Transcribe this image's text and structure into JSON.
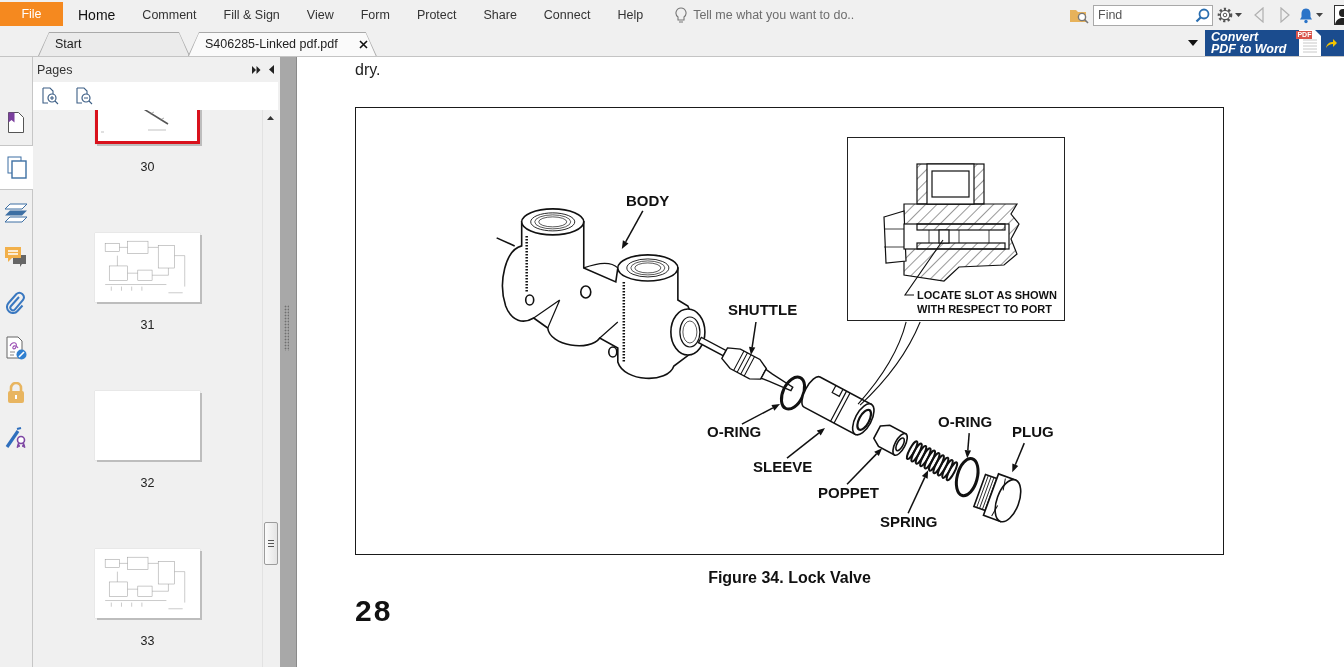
{
  "menu": {
    "file": "File",
    "tabs": [
      {
        "label": "Home",
        "selected": true
      },
      {
        "label": "Comment",
        "selected": false
      },
      {
        "label": "Fill & Sign",
        "selected": false
      },
      {
        "label": "View",
        "selected": false
      },
      {
        "label": "Form",
        "selected": false
      },
      {
        "label": "Protect",
        "selected": false
      },
      {
        "label": "Share",
        "selected": false
      },
      {
        "label": "Connect",
        "selected": false
      },
      {
        "label": "Help",
        "selected": false
      }
    ],
    "tell_me": {
      "placeholder": "Tell me what you want to do.."
    },
    "find": {
      "placeholder": "Find"
    }
  },
  "doc_tabs": [
    {
      "label": "Start",
      "selected": false,
      "closable": false
    },
    {
      "label": "S406285-Linked pdf.pdf",
      "selected": true,
      "closable": true
    }
  ],
  "promo": {
    "lines": [
      "Convert",
      "PDF to Word"
    ],
    "tag": "PDF"
  },
  "side_rail": [
    {
      "selected": false
    },
    {
      "selected": true
    },
    {
      "selected": false
    },
    {
      "selected": false
    },
    {
      "selected": false
    },
    {
      "selected": false
    },
    {
      "selected": false
    },
    {
      "selected": false
    }
  ],
  "pages_panel": {
    "title": "Pages",
    "thumbnails": [
      {
        "page": "30",
        "kind": "illustration",
        "selected": true
      },
      {
        "page": "31",
        "kind": "schematic",
        "selected": false
      },
      {
        "page": "32",
        "kind": "blank",
        "selected": false
      },
      {
        "page": "33",
        "kind": "schematic",
        "selected": false
      }
    ]
  },
  "document": {
    "text": "dry.",
    "figure": {
      "labels": [
        "BODY",
        "SHUTTLE",
        "O-RING",
        "SLEEVE",
        "POPPET",
        "SPRING",
        "O-RING",
        "PLUG"
      ],
      "inset_note": "LOCATE SLOT AS SHOWN WITH RESPECT TO PORT",
      "caption": "Figure 34. Lock Valve"
    },
    "page_number": "28"
  }
}
